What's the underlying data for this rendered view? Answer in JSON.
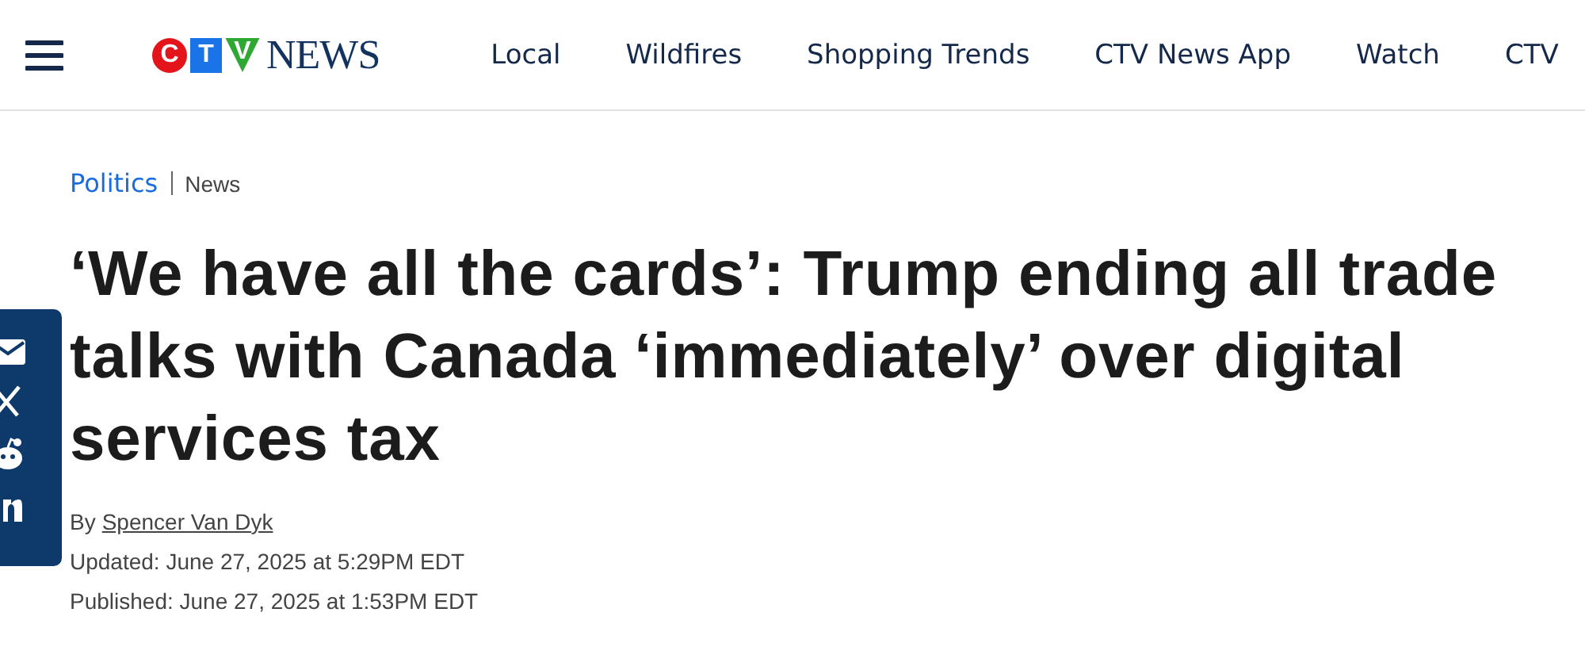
{
  "header": {
    "logo": {
      "letters": [
        "C",
        "T",
        "V"
      ],
      "wordmark": "NEWS"
    },
    "nav": [
      {
        "label": "Local"
      },
      {
        "label": "Wildfires"
      },
      {
        "label": "Shopping Trends"
      },
      {
        "label": "CTV News App"
      },
      {
        "label": "Watch"
      },
      {
        "label": "CTV"
      }
    ]
  },
  "breadcrumb": {
    "section": "Politics",
    "category": "News"
  },
  "headline": "‘We have all the cards’: Trump ending all trade talks with Canada ‘immediately’ over digital services tax",
  "byline": {
    "prefix": "By",
    "author": "Spencer Van Dyk"
  },
  "updated": "Updated: June 27, 2025 at 5:29PM EDT",
  "published": "Published: June 27, 2025 at 1:53PM EDT",
  "share": [
    {
      "kind": "email"
    },
    {
      "kind": "x"
    },
    {
      "kind": "reddit"
    },
    {
      "kind": "linkedin"
    }
  ]
}
